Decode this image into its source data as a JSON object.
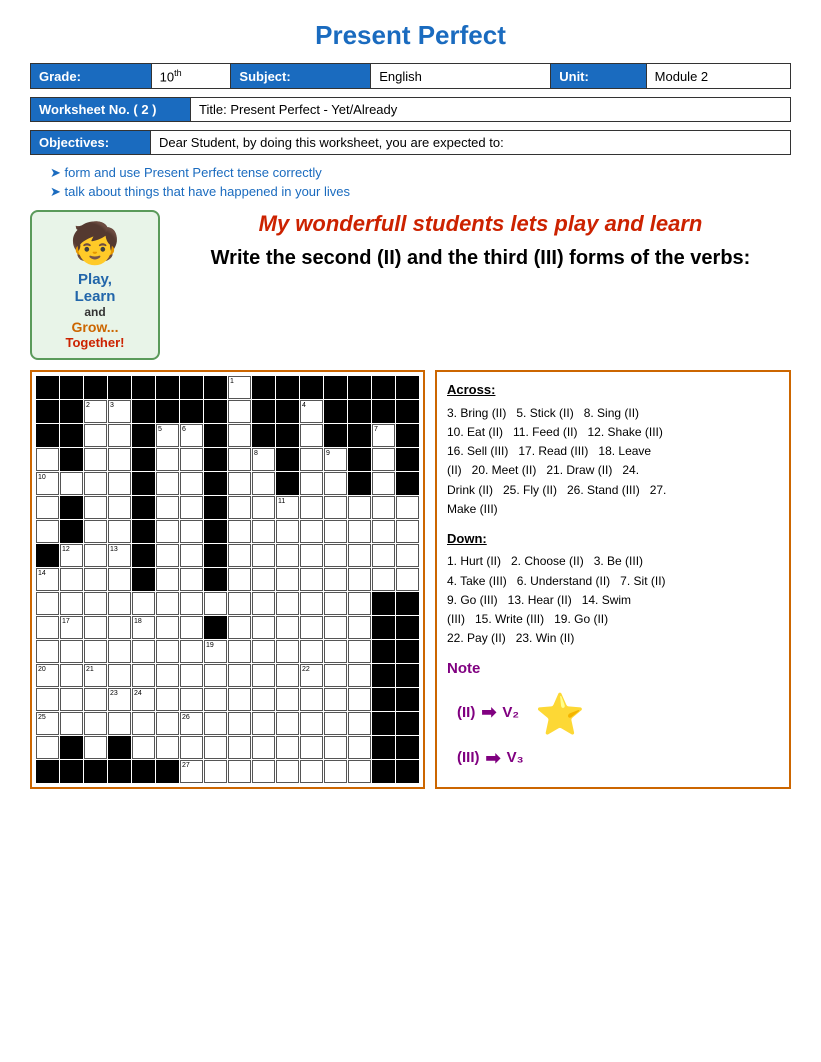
{
  "page": {
    "title": "Present Perfect",
    "grade_label": "Grade:",
    "grade_value": "10",
    "grade_sup": "th",
    "subject_label": "Subject:",
    "subject_value": "English",
    "unit_label": "Unit:",
    "unit_value": "Module 2",
    "worksheet_label": "Worksheet No. ( 2 )",
    "title_label": "Title:",
    "title_value": "Present Perfect - Yet/Already",
    "objectives_label": "Objectives:",
    "objectives_text": "Dear Student, by doing this worksheet, you are expected to:",
    "objective1": "form and use Present Perfect tense correctly",
    "objective2": "talk about things that have happened in your lives",
    "wonderful": "My wonderfull students lets play and learn",
    "write_instruction": "Write the second (II) and the third (III) forms of the verbs:",
    "play_learn": {
      "play": "Play,",
      "learn": "Learn",
      "and": "and",
      "grow": "Grow...",
      "together": "Together!"
    },
    "across_title": "Across:",
    "across_clues": "3. Bring (II)   5. Stick (II)   8. Sing (II)\n10. Eat (II)   11. Feed (II)   12. Shake (III)\n16. Sell (III)   17. Read (III)   18. Leave\n(II)   20. Meet (II)   21. Draw (II)   24.\nDrink (II)   25. Fly (II)   26. Stand (III)   27.\nMake (III)",
    "down_title": "Down:",
    "down_clues": "1. Hurt (II)   2. Choose (II)   3. Be (III)\n4. Take (III)   6. Understand (II)   7. Sit (II)\n9. Go (III)   13. Hear (II)   14. Swim\n(III)   15. Write (III)   19. Go (II)\n22. Pay (II)   23. Win (II)",
    "note_label": "Note",
    "note_ii": "(II)",
    "note_ii_sub": "V₂",
    "note_iii": "(III)",
    "note_iii_sub": "V₃"
  }
}
